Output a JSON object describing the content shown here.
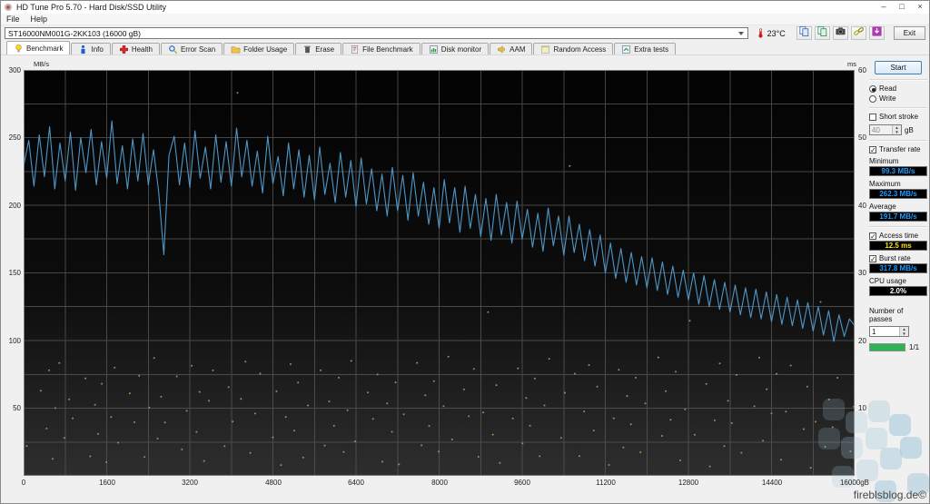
{
  "window": {
    "title": "HD Tune Pro 5.70 - Hard Disk/SSD Utility",
    "menu": [
      "File",
      "Help"
    ],
    "controls": {
      "minimize": "–",
      "maximize": "□",
      "close": "×"
    }
  },
  "toolbar": {
    "drive_selector": "ST16000NM001G-2KK103 (16000 gB)",
    "temperature": "23°C",
    "buttons": [
      {
        "name": "copy-text-button",
        "icon": "copy-icon"
      },
      {
        "name": "copy-image-button",
        "icon": "copy-image-icon"
      },
      {
        "name": "screenshot-button",
        "icon": "camera-icon"
      },
      {
        "name": "link-button",
        "icon": "link-icon"
      },
      {
        "name": "save-results-button",
        "icon": "save-icon"
      }
    ],
    "exit_label": "Exit"
  },
  "tabs": {
    "active": "Benchmark",
    "items": [
      {
        "label": "Benchmark",
        "icon": "bulb-icon"
      },
      {
        "label": "Info",
        "icon": "info-icon"
      },
      {
        "label": "Health",
        "icon": "health-icon"
      },
      {
        "label": "Error Scan",
        "icon": "magnifier-icon"
      },
      {
        "label": "Folder Usage",
        "icon": "folder-icon"
      },
      {
        "label": "Erase",
        "icon": "erase-icon"
      },
      {
        "label": "File Benchmark",
        "icon": "file-icon"
      },
      {
        "label": "Disk monitor",
        "icon": "monitor-icon"
      },
      {
        "label": "AAM",
        "icon": "speaker-icon"
      },
      {
        "label": "Random Access",
        "icon": "random-icon"
      },
      {
        "label": "Extra tests",
        "icon": "extra-icon"
      }
    ]
  },
  "side_panel": {
    "start_button": "Start",
    "mode": {
      "read": "Read",
      "write": "Write",
      "selected": "Read"
    },
    "short_stroke": {
      "label": "Short stroke",
      "checked": false,
      "value": "40",
      "unit": "gB"
    },
    "transfer_rate": {
      "label": "Transfer rate",
      "checked": true
    },
    "minimum": {
      "label": "Minimum",
      "value": "99.3 MB/s"
    },
    "maximum": {
      "label": "Maximum",
      "value": "262.3 MB/s"
    },
    "average": {
      "label": "Average",
      "value": "191.7 MB/s"
    },
    "access_time": {
      "label": "Access time",
      "checked": true,
      "value": "12.5 ms"
    },
    "burst_rate": {
      "label": "Burst rate",
      "checked": true,
      "value": "317.8 MB/s"
    },
    "cpu_usage": {
      "label": "CPU usage",
      "value": "2.0%"
    },
    "passes": {
      "label": "Number of passes",
      "value": "1",
      "progress_label": "1/1",
      "progress_pct": 100
    }
  },
  "colors": {
    "value_blue": "#1e9bff",
    "value_yellow": "#ffe400",
    "progress_green": "#2fb352",
    "transfer_line": "#4e96c8",
    "access_dots": "#a9a24a"
  },
  "watermark": "fireblsblog.de©",
  "chart_data": {
    "type": "line",
    "title": "HD Tune Pro read benchmark - transfer rate and access time vs position",
    "xlabel": "position (gB)",
    "x_range_gB": [
      0,
      16000
    ],
    "x_tick_labels": [
      "0",
      "1600",
      "3200",
      "4800",
      "6400",
      "8000",
      "9600",
      "11200",
      "12800",
      "14400",
      "16000gB"
    ],
    "left_axis": {
      "label": "MB/s",
      "ticks": [
        300,
        250,
        200,
        150,
        100,
        50
      ],
      "range": [
        0,
        300
      ]
    },
    "right_axis": {
      "label": "ms",
      "ticks": [
        60,
        50,
        40,
        30,
        20,
        10
      ],
      "range": [
        0,
        60
      ]
    },
    "grid": {
      "h_step_MBs": 25,
      "v_step_gB": 800
    },
    "stats": {
      "minimum_MBs": 99.3,
      "maximum_MBs": 262.3,
      "average_MBs": 191.7,
      "access_time_ms": 12.5,
      "burst_rate_MBs": 317.8,
      "cpu_usage_pct": 2.0
    },
    "series": [
      {
        "name": "Transfer rate",
        "unit": "MB/s",
        "color": "#4e96c8",
        "x_start_gB": 0,
        "x_step_gB": 100,
        "values": [
          229,
          248,
          214,
          252,
          221,
          258,
          212,
          246,
          218,
          254,
          211,
          250,
          224,
          256,
          215,
          247,
          220,
          262.3,
          216,
          244,
          212,
          249,
          218,
          253,
          215,
          241,
          210,
          163.4,
          237,
          251,
          215,
          246,
          213,
          255,
          220,
          243,
          212,
          252,
          217,
          247,
          214,
          257,
          221,
          248,
          214,
          240,
          209,
          251,
          216,
          236,
          207,
          246,
          212,
          241,
          206,
          237,
          204,
          243,
          208,
          231,
          202,
          239,
          206,
          233,
          199,
          235,
          201,
          227,
          196,
          223,
          192,
          228,
          196,
          222,
          189,
          224,
          192,
          217,
          186,
          213,
          183,
          219,
          187,
          213,
          180,
          214,
          183,
          208,
          177,
          205,
          174,
          208,
          178,
          202,
          172,
          203,
          175,
          197,
          169,
          194,
          166,
          198,
          170,
          192,
          163,
          192,
          165,
          186,
          159,
          182,
          155,
          178,
          150,
          172,
          146,
          168,
          143,
          165,
          141,
          162,
          139,
          161,
          137,
          158,
          134,
          155,
          132,
          152,
          130,
          150,
          127,
          148,
          125,
          145,
          123,
          143,
          121,
          141,
          119,
          139,
          117,
          138,
          116,
          136,
          114,
          134,
          112,
          132,
          111,
          130,
          109,
          128,
          107,
          125,
          104,
          122,
          99.3,
          119,
          103,
          116,
          111
        ]
      },
      {
        "name": "Access time",
        "unit": "ms",
        "color": "#a9a24a",
        "points": [
          [
            130,
            4.2
          ],
          [
            260,
            12.8
          ],
          [
            390,
            7.1
          ],
          [
            455,
            15.6
          ],
          [
            540,
            2.4
          ],
          [
            610,
            9.8
          ],
          [
            705,
            16.9
          ],
          [
            820,
            5.7
          ],
          [
            930,
            11.3
          ],
          [
            1015,
            8.4
          ],
          [
            1120,
            14.2
          ],
          [
            1230,
            3.1
          ],
          [
            1340,
            10.6
          ],
          [
            1415,
            6.2
          ],
          [
            1505,
            13.5
          ],
          [
            1610,
            1.8
          ],
          [
            1720,
            8.9
          ],
          [
            1805,
            16.1
          ],
          [
            1890,
            4.9
          ],
          [
            1975,
            12.1
          ],
          [
            2080,
            7.7
          ],
          [
            2190,
            15.0
          ],
          [
            2310,
            2.9
          ],
          [
            2420,
            10.1
          ],
          [
            2530,
            17.3
          ],
          [
            2615,
            5.3
          ],
          [
            2700,
            11.9
          ],
          [
            2790,
            8.0
          ],
          [
            2880,
            14.7
          ],
          [
            2995,
            3.8
          ],
          [
            3105,
            9.4
          ],
          [
            3220,
            16.5
          ],
          [
            3330,
            6.6
          ],
          [
            3405,
            12.4
          ],
          [
            3510,
            2.1
          ],
          [
            3620,
            10.9
          ],
          [
            3715,
            15.8
          ],
          [
            3800,
            4.5
          ],
          [
            3895,
            13.1
          ],
          [
            3990,
            7.9
          ],
          [
            4100,
            56.4
          ],
          [
            4185,
            11.6
          ],
          [
            4290,
            17.0
          ],
          [
            4400,
            3.4
          ],
          [
            4510,
            9.1
          ],
          [
            4625,
            14.9
          ],
          [
            4730,
            5.9
          ],
          [
            4815,
            12.6
          ],
          [
            4920,
            1.6
          ],
          [
            5030,
            8.6
          ],
          [
            5140,
            16.3
          ],
          [
            5230,
            6.9
          ],
          [
            5320,
            13.9
          ],
          [
            5435,
            2.7
          ],
          [
            5545,
            10.3
          ],
          [
            5650,
            15.4
          ],
          [
            5745,
            4.7
          ],
          [
            5850,
            11.1
          ],
          [
            5960,
            7.4
          ],
          [
            6070,
            14.4
          ],
          [
            6180,
            3.3
          ],
          [
            6270,
            9.9
          ],
          [
            6360,
            17.1
          ],
          [
            6450,
            5.1
          ],
          [
            6560,
            12.2
          ],
          [
            6675,
            8.2
          ],
          [
            6780,
            15.2
          ],
          [
            6890,
            2.2
          ],
          [
            7000,
            10.7
          ],
          [
            7110,
            6.4
          ],
          [
            7195,
            13.6
          ],
          [
            7280,
            1.9
          ],
          [
            7390,
            9.2
          ],
          [
            7505,
            16.7
          ],
          [
            7610,
            4.4
          ],
          [
            7700,
            11.7
          ],
          [
            7790,
            7.6
          ],
          [
            7900,
            14.1
          ],
          [
            8010,
            3.6
          ],
          [
            8120,
            10.2
          ],
          [
            8230,
            17.4
          ],
          [
            8320,
            5.6
          ],
          [
            8410,
            12.9
          ],
          [
            8520,
            8.8
          ],
          [
            8635,
            15.7
          ],
          [
            8740,
            2.6
          ],
          [
            8850,
            9.6
          ],
          [
            8960,
            24.3
          ],
          [
            9070,
            6.1
          ],
          [
            9155,
            13.3
          ],
          [
            9240,
            1.7
          ],
          [
            9350,
            8.7
          ],
          [
            9465,
            16.0
          ],
          [
            9570,
            4.8
          ],
          [
            9660,
            11.4
          ],
          [
            9750,
            7.2
          ],
          [
            9860,
            14.6
          ],
          [
            9970,
            3.0
          ],
          [
            10080,
            10.4
          ],
          [
            10190,
            17.2
          ],
          [
            10280,
            5.4
          ],
          [
            10370,
            12.5
          ],
          [
            10480,
            45.9
          ],
          [
            10595,
            15.1
          ],
          [
            10700,
            2.8
          ],
          [
            10810,
            9.3
          ],
          [
            10920,
            16.6
          ],
          [
            11030,
            6.8
          ],
          [
            11115,
            13.2
          ],
          [
            11200,
            1.5
          ],
          [
            11310,
            8.3
          ],
          [
            11425,
            15.9
          ],
          [
            11530,
            4.3
          ],
          [
            11620,
            11.8
          ],
          [
            11710,
            7.5
          ],
          [
            11820,
            14.3
          ],
          [
            11930,
            3.7
          ],
          [
            12040,
            10.8
          ],
          [
            12150,
            17.5
          ],
          [
            12240,
            5.8
          ],
          [
            12330,
            12.3
          ],
          [
            12440,
            8.5
          ],
          [
            12555,
            15.5
          ],
          [
            12660,
            2.3
          ],
          [
            12770,
            9.7
          ],
          [
            12880,
            22.7
          ],
          [
            12990,
            6.3
          ],
          [
            13075,
            13.7
          ],
          [
            13160,
            1.4
          ],
          [
            13270,
            8.1
          ],
          [
            13385,
            16.4
          ],
          [
            13490,
            4.6
          ],
          [
            13580,
            11.2
          ],
          [
            13670,
            7.8
          ],
          [
            13780,
            14.8
          ],
          [
            13890,
            3.2
          ],
          [
            14000,
            10.5
          ],
          [
            14110,
            17.6
          ],
          [
            14200,
            5.2
          ],
          [
            14290,
            12.7
          ],
          [
            14400,
            9.0
          ],
          [
            14515,
            15.3
          ],
          [
            14620,
            2.5
          ],
          [
            14730,
            9.5
          ],
          [
            14840,
            16.2
          ],
          [
            14950,
            6.7
          ],
          [
            15035,
            13.4
          ],
          [
            15120,
            1.3
          ],
          [
            15230,
            8.0
          ],
          [
            15345,
            25.6
          ],
          [
            15450,
            4.1
          ],
          [
            15540,
            11.5
          ],
          [
            15630,
            7.3
          ],
          [
            15740,
            14.5
          ],
          [
            15850,
            3.5
          ],
          [
            15930,
            10.0
          ]
        ]
      }
    ]
  }
}
